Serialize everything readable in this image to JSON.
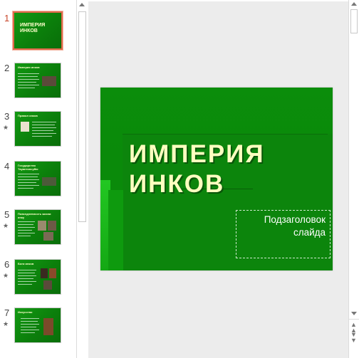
{
  "slides": [
    {
      "number": "1",
      "title": "ИМПЕРИЯ ИНКОВ",
      "has_animation": false,
      "selected": true
    },
    {
      "number": "2",
      "title": "Империя инков",
      "has_animation": false,
      "selected": false
    },
    {
      "number": "3",
      "title": "Правил инков",
      "has_animation": true,
      "selected": false
    },
    {
      "number": "4",
      "title": "Государство Тауантинсуйю",
      "has_animation": false,
      "selected": false
    },
    {
      "number": "5",
      "title": "Повседневность жизни инку",
      "has_animation": true,
      "selected": false
    },
    {
      "number": "6",
      "title": "Боги инков",
      "has_animation": true,
      "selected": false
    },
    {
      "number": "7",
      "title": "Искусство",
      "has_animation": true,
      "selected": false
    }
  ],
  "animation_marker": "★",
  "current_slide": {
    "title_line1": "ИМПЕРИЯ",
    "title_line2": "ИНКОВ",
    "subtitle_line1": "Подзаголовок",
    "subtitle_line2": "слайда"
  },
  "scroll_controls": {
    "previous_slide_glyph": "▲\n▲",
    "next_slide_glyph": "▼\n▼"
  },
  "colors": {
    "slide_green": "#0b8a0b",
    "title_yellow": "#ffffc0",
    "selection_border": "#e0694a"
  }
}
